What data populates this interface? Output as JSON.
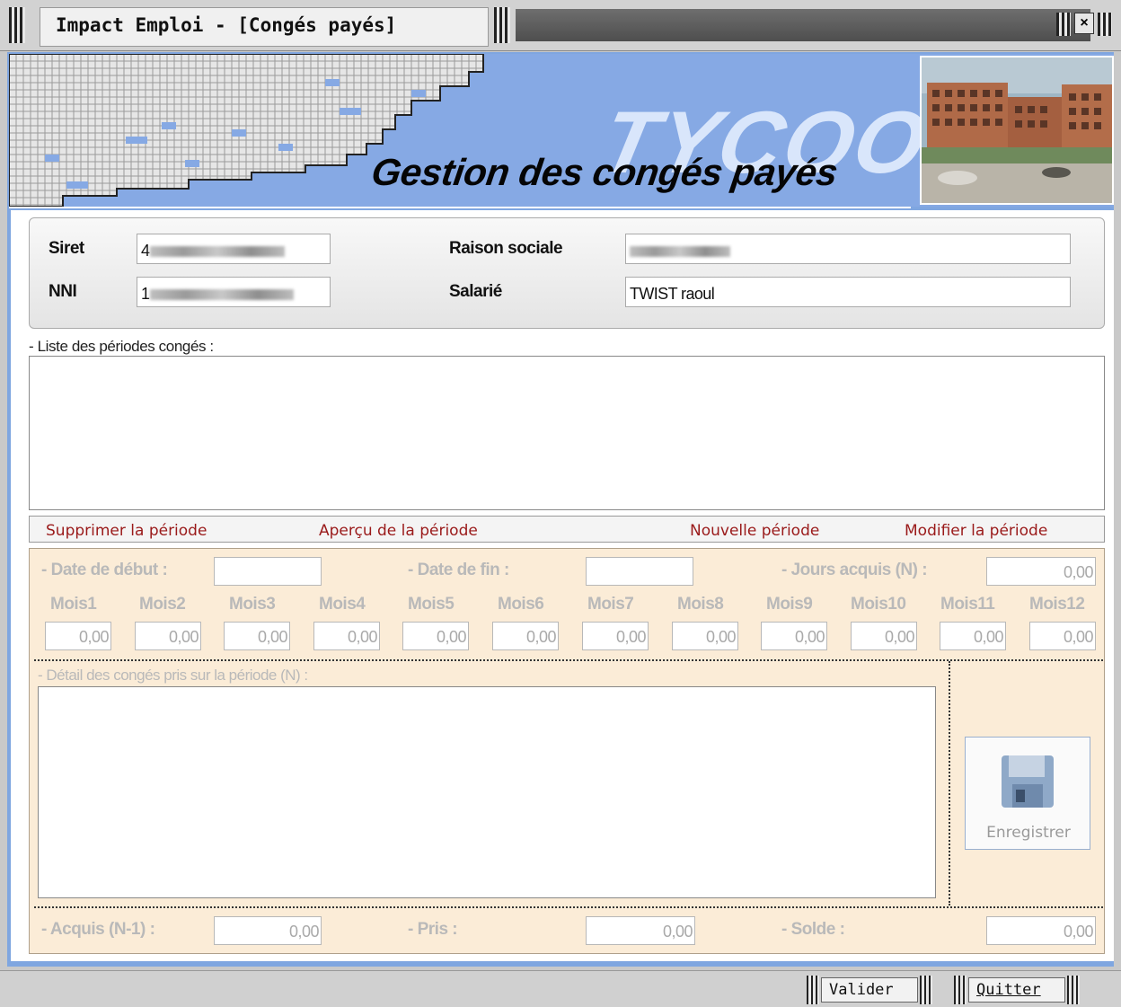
{
  "window": {
    "title": "Impact Emploi - [Congés payés]",
    "close_glyph": "×"
  },
  "banner": {
    "brand": "TYCOON",
    "title": "Gestion des congés payés"
  },
  "employer": {
    "siret_label": "Siret",
    "siret_value": "4",
    "raison_label": "Raison sociale",
    "raison_value": "",
    "nni_label": "NNI",
    "nni_value": "1",
    "salarie_label": "Salarié",
    "salarie_value": "TWIST raoul"
  },
  "periods": {
    "caption": "- Liste des périodes congés :",
    "actions": {
      "delete": "Supprimer la période",
      "preview": "Aperçu de la période",
      "new": "Nouvelle période",
      "edit": "Modifier la période"
    }
  },
  "period_form": {
    "date_debut_label": "- Date de début :",
    "date_debut_value": "",
    "date_fin_label": "- Date de fin :",
    "date_fin_value": "",
    "jours_acquis_label": "- Jours acquis (N) :",
    "jours_acquis_value": "0,00",
    "months": [
      {
        "label": "Mois1",
        "value": "0,00"
      },
      {
        "label": "Mois2",
        "value": "0,00"
      },
      {
        "label": "Mois3",
        "value": "0,00"
      },
      {
        "label": "Mois4",
        "value": "0,00"
      },
      {
        "label": "Mois5",
        "value": "0,00"
      },
      {
        "label": "Mois6",
        "value": "0,00"
      },
      {
        "label": "Mois7",
        "value": "0,00"
      },
      {
        "label": "Mois8",
        "value": "0,00"
      },
      {
        "label": "Mois9",
        "value": "0,00"
      },
      {
        "label": "Mois10",
        "value": "0,00"
      },
      {
        "label": "Mois11",
        "value": "0,00"
      },
      {
        "label": "Mois12",
        "value": "0,00"
      }
    ],
    "detail_caption": "- Détail des congés pris sur la période (N) :",
    "save_label": "Enregistrer",
    "acquis_label": "- Acquis (N-1) :",
    "acquis_value": "0,00",
    "pris_label": "- Pris :",
    "pris_value": "0,00",
    "solde_label": "- Solde :",
    "solde_value": "0,00"
  },
  "footer": {
    "validate_label": "Valider",
    "quit_label": "Quitter"
  },
  "colors": {
    "banner": "#86a9e4",
    "action_text": "#9a1a1a",
    "form_background": "#fbecd7"
  }
}
